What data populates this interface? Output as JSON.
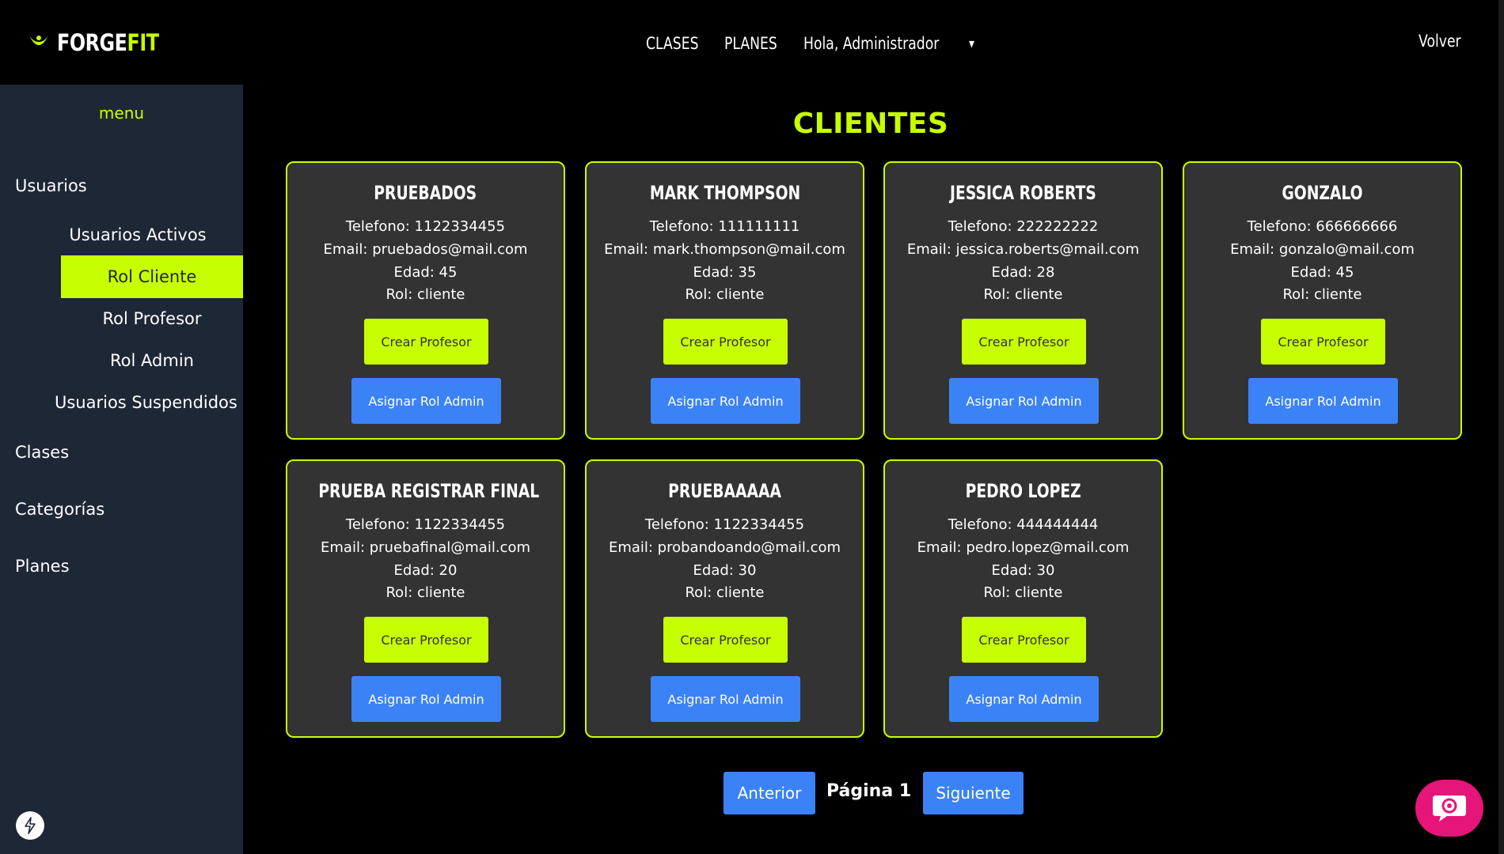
{
  "header": {
    "logo_part1": "FORGE",
    "logo_part2": "FIT",
    "nav_clases": "CLASES",
    "nav_planes": "PLANES",
    "nav_user": "Hola, Administrador",
    "back": "Volver"
  },
  "sidebar": {
    "title": "menu",
    "usuarios": "Usuarios",
    "usuarios_activos": "Usuarios Activos",
    "rol_cliente": "Rol Cliente",
    "rol_profesor": "Rol Profesor",
    "rol_admin": "Rol Admin",
    "usuarios_suspendidos": "Usuarios Suspendidos",
    "clases": "Clases",
    "categorias": "Categorías",
    "planes": "Planes"
  },
  "main": {
    "title": "CLIENTES",
    "btn_prof": "Crear Profesor",
    "btn_admin": "Asignar Rol Admin",
    "cards": [
      {
        "name": "PRUEBADOS",
        "telefono": "Telefono: 1122334455",
        "email": "Email: pruebados@mail.com",
        "edad": "Edad: 45",
        "rol": "Rol: cliente"
      },
      {
        "name": "MARK THOMPSON",
        "telefono": "Telefono: 111111111",
        "email": "Email: mark.thompson@mail.com",
        "edad": "Edad: 35",
        "rol": "Rol: cliente"
      },
      {
        "name": "JESSICA ROBERTS",
        "telefono": "Telefono: 222222222",
        "email": "Email: jessica.roberts@mail.com",
        "edad": "Edad: 28",
        "rol": "Rol: cliente"
      },
      {
        "name": "GONZALO",
        "telefono": "Telefono: 666666666",
        "email": "Email: gonzalo@mail.com",
        "edad": "Edad: 45",
        "rol": "Rol: cliente"
      },
      {
        "name": "PRUEBA REGISTRAR FINAL",
        "telefono": "Telefono: 1122334455",
        "email": "Email: pruebafinal@mail.com",
        "edad": "Edad: 20",
        "rol": "Rol: cliente"
      },
      {
        "name": "PRUEBAAAAA",
        "telefono": "Telefono: 1122334455",
        "email": "Email: probandoando@mail.com",
        "edad": "Edad: 30",
        "rol": "Rol: cliente"
      },
      {
        "name": "PEDRO LOPEZ",
        "telefono": "Telefono: 444444444",
        "email": "Email: pedro.lopez@mail.com",
        "edad": "Edad: 30",
        "rol": "Rol: cliente"
      }
    ]
  },
  "pagination": {
    "prev": "Anterior",
    "label": "Página 1",
    "next": "Siguiente"
  },
  "colors": {
    "accent": "#c8ff00",
    "button_blue": "#3b82f6",
    "sidebar": "#1e2736",
    "card": "#333333",
    "help": "#e5157a"
  },
  "icons": {
    "logo": "forgefit-logo-icon",
    "caret": "caret-down-icon",
    "bolt": "lightning-icon",
    "help": "chat-help-icon"
  }
}
